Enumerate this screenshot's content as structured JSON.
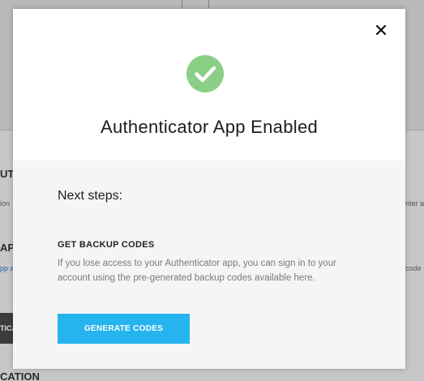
{
  "background": {
    "labels": [
      "UT",
      "AP",
      "CATION"
    ],
    "snippets": [
      "ion",
      "pp a",
      "nter a",
      "code"
    ],
    "button_fragment": "TICA"
  },
  "modal": {
    "title": "Authenticator App Enabled",
    "close_glyph": "×",
    "next_steps": "Next steps:",
    "backup": {
      "heading": "GET BACKUP CODES",
      "description": "If you lose access to your Authenticator app, you can sign in to your account using the pre-generated backup codes available here.",
      "button_label": "GENERATE CODES"
    }
  },
  "colors": {
    "success": "#8bcf86",
    "accent": "#26b4ee"
  }
}
